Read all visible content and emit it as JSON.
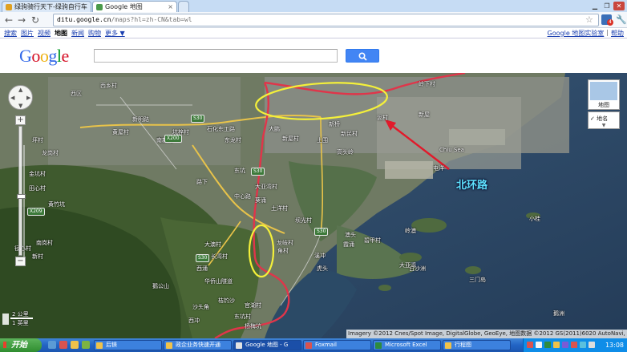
{
  "browser": {
    "tabs": [
      {
        "title": "绿驹骑行天下-绿驹自行车"
      },
      {
        "title": "Google 地图"
      }
    ],
    "url_host": "ditu.google.cn",
    "url_path": "/maps?hl=zh-CN&tab=wl",
    "extension_badge": "4"
  },
  "gbar": {
    "links": [
      "搜索",
      "图片",
      "视频",
      "地图",
      "新闻",
      "购物",
      "更多 ▼"
    ],
    "selected": "地图",
    "right_links": [
      "Google 地图实验室",
      "帮助"
    ]
  },
  "search": {
    "logo_letters": [
      "G",
      "o",
      "o",
      "g",
      "l",
      "e"
    ],
    "query": ""
  },
  "map": {
    "place_labels": [
      {
        "text": "西区",
        "id": "xiqu"
      },
      {
        "text": "西乡村",
        "id": "xixiangcun"
      },
      {
        "text": "新明路",
        "id": "xinminglu"
      },
      {
        "text": "石化东工路",
        "id": "shihua"
      },
      {
        "text": "大鹏",
        "id": "dapeng"
      },
      {
        "text": "坪村",
        "id": "pingcun"
      },
      {
        "text": "黄屋村",
        "id": "huangwucun"
      },
      {
        "text": "南新村",
        "id": "nanxincun"
      },
      {
        "text": "东龙村",
        "id": "donglongcun"
      },
      {
        "text": "坑梓村",
        "id": "kengzicun"
      },
      {
        "text": "新屋村",
        "id": "xinwucun"
      },
      {
        "text": "上围",
        "id": "shangwei"
      },
      {
        "text": "新民村",
        "id": "xinmincun"
      },
      {
        "text": "新桥",
        "id": "xinqiao"
      },
      {
        "text": "金坑村",
        "id": "jinkengcun"
      },
      {
        "text": "龙岗村",
        "id": "longgangcun"
      },
      {
        "text": "田心村",
        "id": "tianxincun"
      },
      {
        "text": "黄竹坑",
        "id": "huangzhukeng"
      },
      {
        "text": "路下",
        "id": "luxia"
      },
      {
        "text": "东坑",
        "id": "dongkeng"
      },
      {
        "text": "大亚湾村",
        "id": "dayawancun"
      },
      {
        "text": "葵涌",
        "id": "kuichong"
      },
      {
        "text": "土洋村",
        "id": "tuyangcun"
      },
      {
        "text": "坝光村",
        "id": "baguangcun"
      },
      {
        "text": "中心路",
        "id": "zhongxinlu"
      },
      {
        "text": "霞涌",
        "id": "xiachong"
      },
      {
        "text": "虎头",
        "id": "hutou"
      },
      {
        "text": "碧甲村",
        "id": "bijiacun"
      },
      {
        "text": "Chiu Sea",
        "id": "chiusea"
      },
      {
        "text": "新屋",
        "id": "xinwu"
      },
      {
        "text": "岭下村",
        "id": "lingxiacun"
      },
      {
        "text": "泥村",
        "id": "nicun"
      },
      {
        "text": "高头岭",
        "id": "gaotouling"
      },
      {
        "text": "溪冲",
        "id": "xichong"
      },
      {
        "text": "屯洋",
        "id": "tunyang"
      },
      {
        "text": "长湾村",
        "id": "changwancun"
      },
      {
        "text": "角村",
        "id": "jiaocun"
      },
      {
        "text": "龙岐村",
        "id": "longqicun"
      },
      {
        "text": "新村",
        "id": "xincun"
      },
      {
        "text": "南岗村",
        "id": "nangangcun"
      },
      {
        "text": "径心村",
        "id": "jingxincun"
      },
      {
        "text": "大澳村",
        "id": "daaocun"
      },
      {
        "text": "西涌",
        "id": "xichong2"
      },
      {
        "text": "岭澳",
        "id": "lingao"
      },
      {
        "text": "澳头",
        "id": "aotou"
      },
      {
        "text": "白沙洲",
        "id": "baishazhou"
      },
      {
        "text": "三门岛",
        "id": "sanmendao"
      },
      {
        "text": "华侨山隧道",
        "id": "huaqiaoshan"
      },
      {
        "text": "鹅公山",
        "id": "egongshan"
      },
      {
        "text": "桔钓沙",
        "id": "jiediaosha"
      },
      {
        "text": "官湖村",
        "id": "guanhucun"
      },
      {
        "text": "鹅洲",
        "id": "ezhou"
      },
      {
        "text": "沙头角",
        "id": "shatoujiao"
      },
      {
        "text": "东坑村",
        "id": "dongkengcun"
      },
      {
        "text": "杨梅坑",
        "id": "yangmeikeng"
      },
      {
        "text": "西冲",
        "id": "xichong3"
      },
      {
        "text": "小桂",
        "id": "xiaogui"
      },
      {
        "text": "大亚湾",
        "id": "dayawan"
      }
    ],
    "road_shields": [
      "S30",
      "X200",
      "S30",
      "X209",
      "S30",
      "S30"
    ],
    "annotation_label": "北环路",
    "controls": {
      "zoom_in": "+",
      "zoom_out": "−"
    },
    "map_type": {
      "label": "地图"
    },
    "labels_toggle": {
      "label": "地名",
      "checked": "✓"
    },
    "scale": {
      "top": "2 公里",
      "bottom": "1 英里"
    },
    "imagery_credit": "Imagery ©2012 Cnes/Spot Image, DigitalGlobe, GeoEye, 地图数据 ©2012 GS(2011)6020 AutoNavi, Google -"
  },
  "taskbar": {
    "start_label": "开始",
    "buttons": [
      {
        "label": "后镁",
        "color": "#f0c24a"
      },
      {
        "label": "政企业务快速开通",
        "color": "#f0c24a"
      },
      {
        "label": "Google 地图 - G",
        "color": "#e2e2e2",
        "active": true
      },
      {
        "label": "Foxmail",
        "color": "#d9534f"
      },
      {
        "label": "Microsoft Excel",
        "color": "#2e8b3e"
      },
      {
        "label": "行程图",
        "color": "#f0c24a"
      }
    ],
    "clock": "13:08"
  },
  "colors": {
    "google_blue": "#4285f4",
    "route_red": "#e0354a",
    "ellipse_yellow": "#f4f03a",
    "arrow_red": "#e11a2b",
    "annotation_cyan": "#5fe3ff"
  }
}
